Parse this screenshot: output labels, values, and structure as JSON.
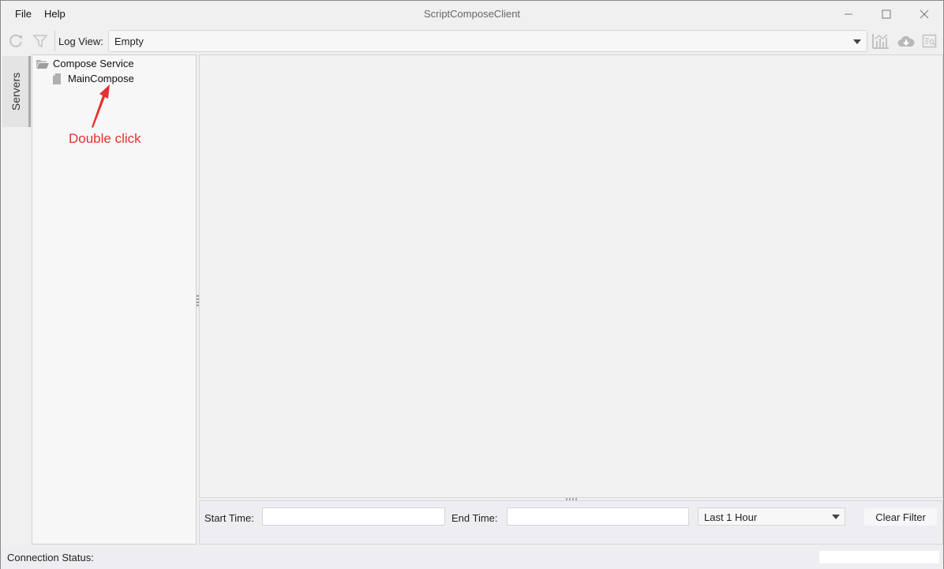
{
  "window": {
    "title": "ScriptComposeClient",
    "menu": [
      "File",
      "Help"
    ],
    "controls": [
      "minimize",
      "maximize",
      "close"
    ]
  },
  "toolbar": {
    "left_icons": [
      "refresh-icon",
      "filter-icon"
    ],
    "log_view_label": "Log View:",
    "log_view_value": "Empty",
    "right_icons": [
      "chart-icon",
      "cloud-download-icon",
      "log-search-icon"
    ]
  },
  "sidebar": {
    "tab_label": "Servers",
    "tree": [
      {
        "label": "Compose Service",
        "icon": "folder-open-icon",
        "level": 0
      },
      {
        "label": "MainCompose",
        "icon": "document-icon",
        "level": 1
      }
    ]
  },
  "annotation": {
    "text": "Double click",
    "color": "#e53131"
  },
  "filter": {
    "start_time_label": "Start Time:",
    "start_time_value": "",
    "end_time_label": "End Time:",
    "end_time_value": "",
    "range_selected": "Last 1 Hour",
    "clear_label": "Clear Filter"
  },
  "status": {
    "connection_label": "Connection Status:",
    "connection_value": ""
  }
}
